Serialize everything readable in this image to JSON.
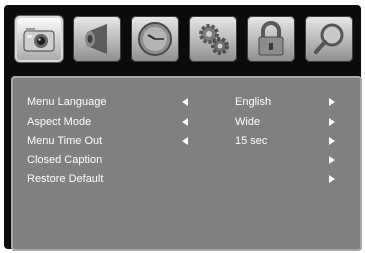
{
  "tabs": [
    {
      "icon": "picture-camera-icon"
    },
    {
      "icon": "sound-speaker-icon"
    },
    {
      "icon": "clock-icon"
    },
    {
      "icon": "gears-icon"
    },
    {
      "icon": "padlock-icon"
    },
    {
      "icon": "magnifier-icon"
    }
  ],
  "menu": {
    "items": [
      {
        "label": "Menu Language",
        "value": "English"
      },
      {
        "label": "Aspect Mode",
        "value": "Wide"
      },
      {
        "label": "Menu Time Out",
        "value": "15 sec"
      },
      {
        "label": "Closed Caption",
        "value": ""
      },
      {
        "label": "Restore Default",
        "value": ""
      }
    ]
  },
  "colors": {
    "frame": "#0b0b0b",
    "panel": "#808080",
    "text": "#ffffff"
  }
}
